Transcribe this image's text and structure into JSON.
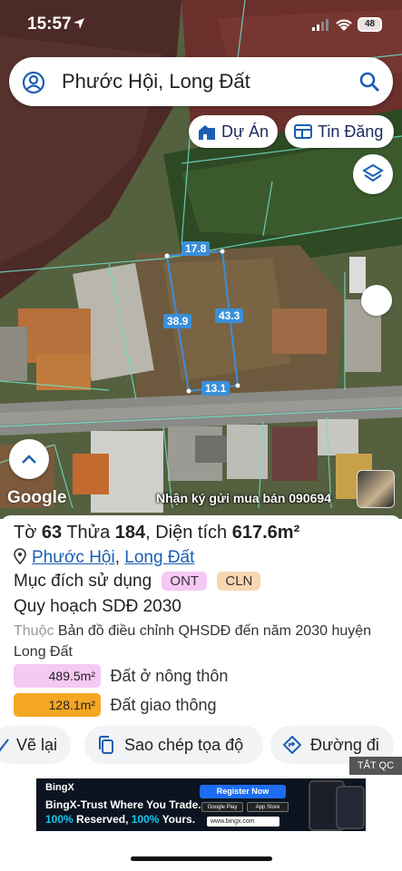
{
  "status_bar": {
    "time": "15:57",
    "battery": "48"
  },
  "search": {
    "query": "Phước Hội, Long Đất"
  },
  "map_chips": {
    "project": "Dự Án",
    "listings": "Tin Đăng"
  },
  "measurements": {
    "top": "17.8",
    "left": "38.9",
    "right": "43.3",
    "bottom": "13.1"
  },
  "map": {
    "attribution": "Google",
    "ad_text": "Nhận ký gửi mua bán 090694"
  },
  "parcel": {
    "title_pre": "Tờ ",
    "sheet": "63",
    "title_mid1": " Thửa ",
    "plot": "184",
    "title_mid2": ", Diện tích ",
    "area": "617.6m²",
    "ward": "Phước Hội",
    "separator": ", ",
    "district": "Long Đất",
    "purpose_label": "Mục đích sử dụng",
    "purpose_tags": [
      "ONT",
      "CLN"
    ],
    "plan_title": "Quy hoạch SDĐ 2030",
    "belongs_prefix": "Thuộc",
    "belongs_text": "Bản đồ điều chỉnh QHSDĐ đến năm 2030 huyện Long Đất",
    "zones": [
      {
        "area": "489.5m²",
        "label": "Đất ở nông thôn",
        "color": "#f6c8f4"
      },
      {
        "area": "128.1m²",
        "label": "Đất giao thông",
        "color": "#f5a623"
      }
    ]
  },
  "actions": {
    "redraw": "Vẽ lại",
    "copy_coords": "Sao chép tọa độ",
    "route": "Đường đi"
  },
  "hide_ads": "TẮT QC",
  "ad_banner": {
    "brand": "BingX",
    "line1": "BingX-Trust Where You Trade.",
    "pct1": "100%",
    "reserved": " Reserved, ",
    "pct2": "100%",
    "yours": " Yours.",
    "register": "Register Now",
    "google_play": "Google Play",
    "app_store": "App Store",
    "site": "www.bingx.com"
  },
  "colors": {
    "accent_blue": "#1a5fb4",
    "measure_blue": "#3a8fd8",
    "ont_pink": "#f6c8f4",
    "transport_orange": "#f5a623"
  }
}
